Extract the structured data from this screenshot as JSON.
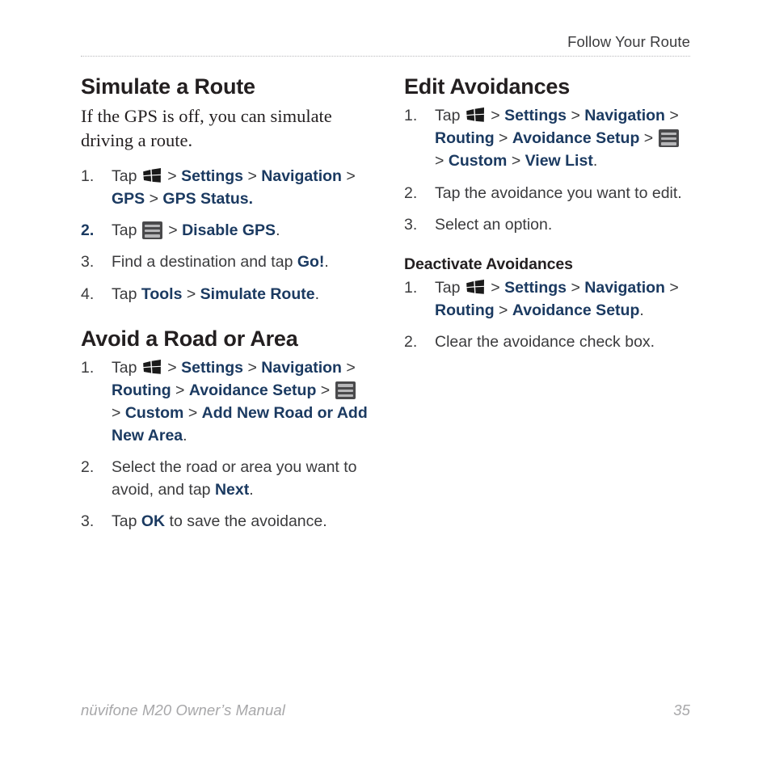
{
  "header": {
    "title": "Follow Your Route"
  },
  "footer": {
    "manual_title": "nüvifone M20 Owner’s Manual",
    "page_number": "35"
  },
  "colors": {
    "ui_term_blue": "#1b3a61",
    "body_gray": "#3b3b3d",
    "heading_black": "#231f20",
    "footer_gray": "#a7a7a9",
    "rule_gray": "#b9b9bb"
  },
  "left_column": {
    "sections": [
      {
        "heading": "Simulate a Route",
        "intro": "If the GPS is off, you can simulate driving a route.",
        "steps": [
          {
            "number": "1.",
            "number_accent": false,
            "parts": [
              {
                "type": "text",
                "value": "Tap "
              },
              {
                "type": "icon",
                "value": "windows-start-icon"
              },
              {
                "type": "sep",
                "value": " > "
              },
              {
                "type": "ui",
                "value": "Settings"
              },
              {
                "type": "sep",
                "value": " > "
              },
              {
                "type": "ui",
                "value": "Navigation"
              },
              {
                "type": "sep",
                "value": " > "
              },
              {
                "type": "ui",
                "value": "GPS"
              },
              {
                "type": "sep",
                "value": " > "
              },
              {
                "type": "ui",
                "value": "GPS Status."
              }
            ]
          },
          {
            "number": "2.",
            "number_accent": true,
            "parts": [
              {
                "type": "text",
                "value": "Tap "
              },
              {
                "type": "icon",
                "value": "menu-list-icon"
              },
              {
                "type": "sep",
                "value": " > "
              },
              {
                "type": "ui",
                "value": "Disable GPS"
              },
              {
                "type": "text",
                "value": "."
              }
            ]
          },
          {
            "number": "3.",
            "number_accent": false,
            "parts": [
              {
                "type": "text",
                "value": "Find a destination and tap "
              },
              {
                "type": "ui",
                "value": "Go!"
              },
              {
                "type": "text",
                "value": "."
              }
            ]
          },
          {
            "number": "4.",
            "number_accent": false,
            "parts": [
              {
                "type": "text",
                "value": "Tap "
              },
              {
                "type": "ui",
                "value": "Tools"
              },
              {
                "type": "sep",
                "value": " > "
              },
              {
                "type": "ui",
                "value": "Simulate Route"
              },
              {
                "type": "text",
                "value": "."
              }
            ]
          }
        ]
      },
      {
        "heading": "Avoid a Road or Area",
        "intro": null,
        "steps": [
          {
            "number": "1.",
            "number_accent": false,
            "parts": [
              {
                "type": "text",
                "value": "Tap "
              },
              {
                "type": "icon",
                "value": "windows-start-icon"
              },
              {
                "type": "sep",
                "value": " > "
              },
              {
                "type": "ui",
                "value": "Settings"
              },
              {
                "type": "sep",
                "value": " > "
              },
              {
                "type": "ui",
                "value": "Navigation"
              },
              {
                "type": "sep",
                "value": " > "
              },
              {
                "type": "ui",
                "value": "Routing"
              },
              {
                "type": "sep",
                "value": " > "
              },
              {
                "type": "ui",
                "value": "Avoidance Setup"
              },
              {
                "type": "sep",
                "value": " > "
              },
              {
                "type": "icon",
                "value": "menu-list-icon"
              },
              {
                "type": "sep",
                "value": " > "
              },
              {
                "type": "ui",
                "value": "Custom"
              },
              {
                "type": "sep",
                "value": " > "
              },
              {
                "type": "ui",
                "value": "Add New Road or Add New Area"
              },
              {
                "type": "text",
                "value": "."
              }
            ]
          },
          {
            "number": "2.",
            "number_accent": false,
            "parts": [
              {
                "type": "text",
                "value": "Select the road or area you want to avoid, and tap "
              },
              {
                "type": "ui",
                "value": "Next"
              },
              {
                "type": "text",
                "value": "."
              }
            ]
          },
          {
            "number": "3.",
            "number_accent": false,
            "parts": [
              {
                "type": "text",
                "value": "Tap "
              },
              {
                "type": "ui",
                "value": "OK"
              },
              {
                "type": "text",
                "value": " to save the avoidance."
              }
            ]
          }
        ]
      }
    ]
  },
  "right_column": {
    "sections": [
      {
        "heading": "Edit Avoidances",
        "heading_level": "h1",
        "steps": [
          {
            "number": "1.",
            "number_accent": false,
            "parts": [
              {
                "type": "text",
                "value": "Tap "
              },
              {
                "type": "icon",
                "value": "windows-start-icon"
              },
              {
                "type": "sep",
                "value": " > "
              },
              {
                "type": "ui",
                "value": "Settings"
              },
              {
                "type": "sep",
                "value": " > "
              },
              {
                "type": "ui",
                "value": "Navigation"
              },
              {
                "type": "sep",
                "value": " > "
              },
              {
                "type": "ui",
                "value": "Routing"
              },
              {
                "type": "sep",
                "value": " > "
              },
              {
                "type": "ui",
                "value": "Avoidance Setup"
              },
              {
                "type": "sep",
                "value": " > "
              },
              {
                "type": "icon",
                "value": "menu-list-icon"
              },
              {
                "type": "sep",
                "value": " > "
              },
              {
                "type": "ui",
                "value": "Custom"
              },
              {
                "type": "sep",
                "value": " > "
              },
              {
                "type": "ui",
                "value": "View List"
              },
              {
                "type": "text",
                "value": "."
              }
            ]
          },
          {
            "number": "2.",
            "number_accent": false,
            "parts": [
              {
                "type": "text",
                "value": "Tap the avoidance you want to edit."
              }
            ]
          },
          {
            "number": "3.",
            "number_accent": false,
            "parts": [
              {
                "type": "text",
                "value": "Select an option."
              }
            ]
          }
        ]
      },
      {
        "heading": "Deactivate Avoidances",
        "heading_level": "h2",
        "steps": [
          {
            "number": "1.",
            "number_accent": false,
            "parts": [
              {
                "type": "text",
                "value": "Tap "
              },
              {
                "type": "icon",
                "value": "windows-start-icon"
              },
              {
                "type": "sep",
                "value": " > "
              },
              {
                "type": "ui",
                "value": "Settings"
              },
              {
                "type": "sep",
                "value": " > "
              },
              {
                "type": "ui",
                "value": "Navigation"
              },
              {
                "type": "sep",
                "value": " > "
              },
              {
                "type": "ui",
                "value": "Routing"
              },
              {
                "type": "sep",
                "value": " > "
              },
              {
                "type": "ui",
                "value": "Avoidance Setup"
              },
              {
                "type": "text",
                "value": "."
              }
            ]
          },
          {
            "number": "2.",
            "number_accent": false,
            "parts": [
              {
                "type": "text",
                "value": "Clear the avoidance check box."
              }
            ]
          }
        ]
      }
    ]
  }
}
